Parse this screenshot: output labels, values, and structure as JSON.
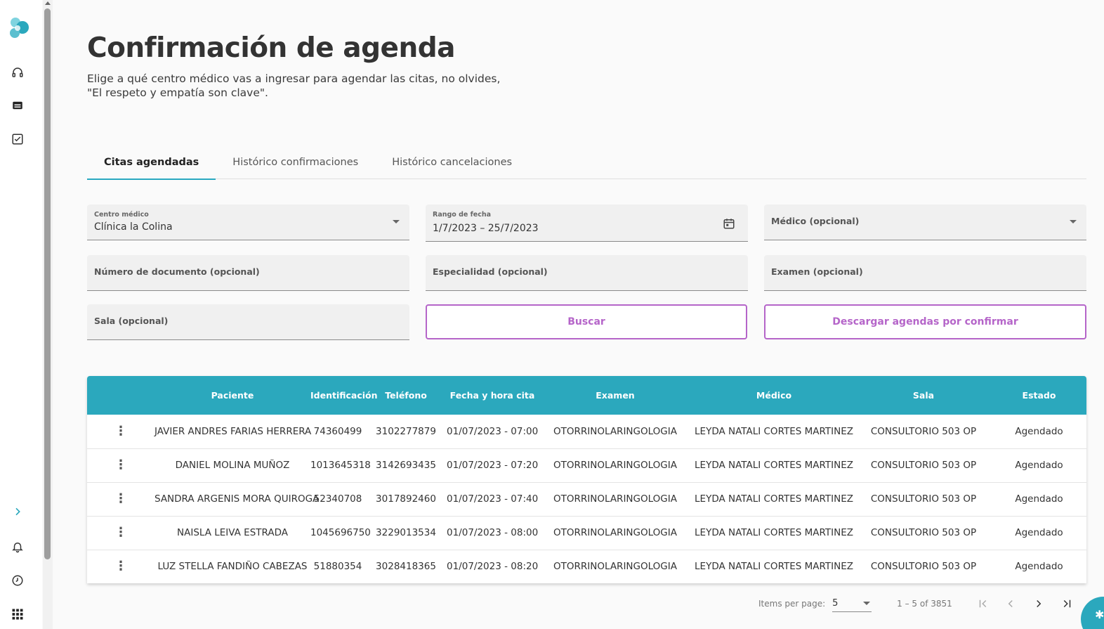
{
  "header": {
    "title": "Confirmación de agenda",
    "subtitle_line1": "Elige a qué centro médico vas a ingresar para agendar las citas, no olvides,",
    "subtitle_line2": "\"El respeto y empatía son clave\"."
  },
  "tabs": [
    {
      "label": "Citas agendadas",
      "active": true
    },
    {
      "label": "Histórico confirmaciones",
      "active": false
    },
    {
      "label": "Histórico cancelaciones",
      "active": false
    }
  ],
  "filters": {
    "centro": {
      "label": "Centro médico",
      "value": "Clínica la Colina"
    },
    "rango": {
      "label": "Rango de fecha",
      "value": "1/7/2023 – 25/7/2023"
    },
    "medico": {
      "placeholder": "Médico (opcional)"
    },
    "documento": {
      "placeholder": "Número de documento (opcional)"
    },
    "especialidad": {
      "placeholder": "Especialidad (opcional)"
    },
    "examen": {
      "placeholder": "Examen (opcional)"
    },
    "sala": {
      "placeholder": "Sala (opcional)"
    },
    "buscar_label": "Buscar",
    "descargar_label": "Descargar agendas por confirmar"
  },
  "table": {
    "columns": [
      "",
      "Paciente",
      "Identificación",
      "Teléfono",
      "Fecha y hora cita",
      "Examen",
      "Médico",
      "Sala",
      "Estado"
    ],
    "rows": [
      {
        "paciente": "JAVIER ANDRES FARIAS HERRERA",
        "id": "74360499",
        "tel": "3102277879",
        "fecha": "01/07/2023 - 07:00",
        "examen": "OTORRINOLARINGOLOGIA",
        "medico": "LEYDA NATALI CORTES MARTINEZ",
        "sala": "CONSULTORIO 503 OP",
        "estado": "Agendado"
      },
      {
        "paciente": "DANIEL MOLINA MUÑOZ",
        "id": "1013645318",
        "tel": "3142693435",
        "fecha": "01/07/2023 - 07:20",
        "examen": "OTORRINOLARINGOLOGIA",
        "medico": "LEYDA NATALI CORTES MARTINEZ",
        "sala": "CONSULTORIO 503 OP",
        "estado": "Agendado"
      },
      {
        "paciente": "SANDRA ARGENIS MORA QUIROGA",
        "id": "52340708",
        "tel": "3017892460",
        "fecha": "01/07/2023 - 07:40",
        "examen": "OTORRINOLARINGOLOGIA",
        "medico": "LEYDA NATALI CORTES MARTINEZ",
        "sala": "CONSULTORIO 503 OP",
        "estado": "Agendado"
      },
      {
        "paciente": "NAISLA LEIVA ESTRADA",
        "id": "1045696750",
        "tel": "3229013534",
        "fecha": "01/07/2023 - 08:00",
        "examen": "OTORRINOLARINGOLOGIA",
        "medico": "LEYDA NATALI CORTES MARTINEZ",
        "sala": "CONSULTORIO 503 OP",
        "estado": "Agendado"
      },
      {
        "paciente": "LUZ STELLA FANDIÑO CABEZAS",
        "id": "51880354",
        "tel": "3028418365",
        "fecha": "01/07/2023 - 08:20",
        "examen": "OTORRINOLARINGOLOGIA",
        "medico": "LEYDA NATALI CORTES MARTINEZ",
        "sala": "CONSULTORIO 503 OP",
        "estado": "Agendado"
      }
    ]
  },
  "paginator": {
    "items_label": "Items per page:",
    "page_size": "5",
    "range": "1 – 5 of 3851"
  },
  "colors": {
    "accent": "#2ba8bd",
    "button": "#b565c9"
  }
}
